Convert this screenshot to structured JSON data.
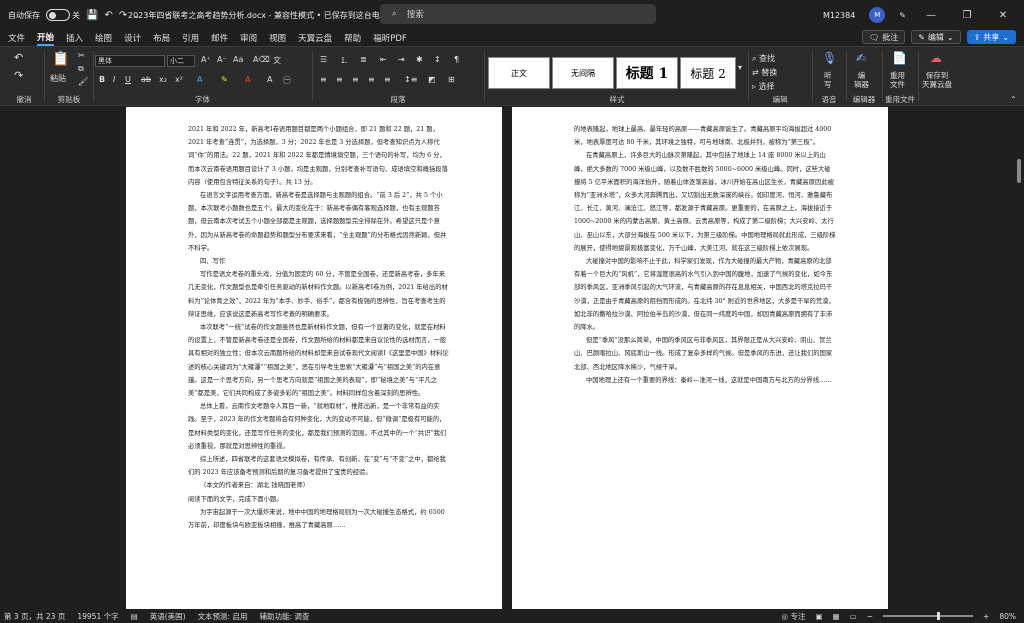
{
  "titlebar": {
    "autosave_label": "自动保存",
    "autosave_state": "关",
    "document_title": "2023年四省联考之高考趋势分析.docx  -  兼容性模式 • 已保存到这台电脑",
    "search_placeholder": "搜索",
    "user_name": "M12384",
    "avatar_initial": "M"
  },
  "tabs": [
    "文件",
    "开始",
    "插入",
    "绘图",
    "设计",
    "布局",
    "引用",
    "邮件",
    "审阅",
    "视图",
    "天翼云盘",
    "帮助",
    "福昕PDF"
  ],
  "tabs_right": {
    "comment": "批注",
    "edit": "编辑",
    "share": "共享"
  },
  "ribbon": {
    "groups": [
      "撤消",
      "剪贴板",
      "字体",
      "段落",
      "样式",
      "编辑",
      "语音",
      "编辑器",
      "重用文件"
    ],
    "paste_label": "粘贴",
    "font_name": "黑体",
    "font_size": "小二",
    "styles": [
      "正文",
      "无间隔",
      "标题 1",
      "标题 2"
    ],
    "find": "查找",
    "replace": "替换",
    "select": "选择",
    "dictate": "听\n写",
    "editor": "编\n辑器",
    "reuse": "重用\n文件",
    "save_cloud": "保存到\n天翼云盘"
  },
  "left_page": [
    {
      "t": "2021 年和 2022 年，新高考Ⅰ卷语用题目都是两个小题组合，即 21 题和 22 题，21 题，2021 年考查“连贯”，为选择题，3 分；2022 年也是 3 分选择题，但考查知识点为人称代词“你”的用法。22 题，2021 年和 2022 年都是情境填空题，三个语句的补写，均为 6 分，而本次云南卷语用题目设计了 3 小题，均是主观题，分别考查补写语句、成语填空和概括段落内容（使用包含特征关系的句子）。共 13 分。",
      "ind": false
    },
    {
      "t": "在语言文字运用考查方面，新高考卷是选择题与主观题的组合。“前 3 后 2”，共 5 个小题，本次联考小题数也是五个。最大的变化在于：新高考卷偶有客观选择题，也有主观题答题，但云南本次考试五个小题全部都是主观题，选择题题型完全排除在外。希望这只是个意外，因为从新高考卷的命题趋势和题型分布要求来看，“全主观题”的分布格式因然新颖，但并不科学。",
      "ind": true
    },
    {
      "t": "四、写作",
      "ind": true
    },
    {
      "t": "写作是语文考卷的重头戏，分值为固定的 60 分，不管是全国卷，还是新高考卷，多年来几无变化，作文题型也是牵引任务驱动的新材料作文题。以新高考Ⅰ卷为例，2021 年给出的材料为“论体育之效”，2022 年为“本手、妙手、俗手”，都含有极强的思辨性，旨在考查考生的辩证思维，应该说这是新高考写作考查的明确要求。",
      "ind": true
    },
    {
      "t": "本次联考“一统”试卷的作文题虽然也是新材料作文题，但有一个显著的变化，就是在材料的设置上，不管是新高考卷还是全国卷，作文题所给的材料都是来自议论性的选材而言，一般具有相对的独立性；但本次云南题所给的材料却是来自试卷现代文阅读Ⅰ《这里是中国》材料论述的核心关键词为“大雍瀑”“祖国之美”，恶在引导考生思索“大雍瀑”与“祖国之美”的内在意蕴。这是一个思考方向，另一个思考方向就是“祖国之美的表现”，即“秘境之美”与“平凡之美”都是美，它们共同构成了多姿多彩的“祖国之美”。材料同样包含着深刻的思辨性。",
      "ind": true
    },
    {
      "t": "总体上看，云南作文考题令人耳目一新，“就地取材”，推陈出新，是一个非常有益的实践。至于，2023 年的作文考题将会有何种变化，大的变动不可能，但“微调”是极有可能的，是材料类型的变化，还是写作任务的变化，都是我们预测的范围，不过其中的一个“共识”我们必须重视，那就是对思辨性的重视。",
      "ind": true
    },
    {
      "t": "综上所述，四省联考的这套语文模拟卷，有传承、有创新，在“变”与“不变”之中，都给我们的 2023 年应该备考预测和后期的复习备考提供了宝贵的经验。",
      "ind": true
    },
    {
      "t": "（本文的作者来自：湖北 钱晓国老师）",
      "ind": true
    },
    {
      "t": "阅读下面的文字，完成下面小题。",
      "ind": false
    },
    {
      "t": "为宇宙起源于一次大爆炸来说，地中中国的地理格局则为一次大碰撞生态格式，约 6500 万年前，印度板块与欧亚板块相撞，推高了青藏高原……",
      "ind": true
    }
  ],
  "right_page": [
    {
      "t": "的地表隆起，地球上最高、最年轻的高原——青藏高原诞生了。青藏高原平均海拔超过 4000 米，地表厚度可达 80 千米，其环境之独特，可与地球南、北极并列，被称为“第三极”。",
      "ind": false
    },
    {
      "t": "在青藏高原上，许多巨大的山脉次第隆起，其中包括了地球上 14 座 8000 米以上的山峰，绝大多数的 7000 米级山峰，以及数不胜数的 5000~6000 米级山峰。同时，这些大碰撞将 5 亿平米面积的海洋抬升，随着山体逐渐高耸，冰川开始在高山区生长，青藏高原因此被称为“亚洲水塔”，众多大河奔腾而出，又切割出无数深邃的峡谷。如印度河、恒河、雅鲁藏布江、长江、黄河、澜沧江、怒江等，都发源于青藏高原。更重要的，在高原之上，海拔接近于 1000~2000 米的内蒙古高原、黄土高原、云贵高原等，构成了第二级阶梯；大兴安岭、太行山、巫山以东，大部分海拔在 500 米以下，为第三级阶梯。中国地理格局就此形成，三级阶梯的展开，使得地貌景观极富变化，万千山峰，大美江河，就在这三级阶梯上依次展现。",
      "ind": true
    },
    {
      "t": "大碰撞对中国的影响不止于此，科学家们发现，作为大碰撞的最大产物，青藏高原的北部有着一个巨大的“风机”，它将湿度很高的水气引入到中国的腹地，加速了气候的变化，如今东部的季风区，亚洲季风引起的大气环流，与青藏高原的存在息息相关，中国西北的塔克拉玛干沙漠，正是由于青藏高原的阻挡而形成的。在北纬 30° 附近的世界地区，大多是干旱的荒漠，如北非的撒哈拉沙漠、阿拉伯半岛的沙漠，但在同一纬度的中国，却因青藏高原而拥有了丰沛的降水。",
      "ind": true
    },
    {
      "t": "但是“季风”没那么简单，中国的季风区与非季风区，其界限正是从大兴安岭、阴山、贺兰山、巴颜喀拉山、冈底斯山一线。形成了复杂多样的气候。但是季风的东进，还让我们的国家北部、西北地区降水稀少，气候干旱。",
      "ind": true
    },
    {
      "t": "中国地理上还有一个重要的界线：秦岭—淮河一线，这就是中国南方与北方的分界线……",
      "ind": true
    }
  ],
  "status": {
    "page": "第 3 页，共 23 页",
    "words": "19951 个字",
    "lang": "英语(美国)",
    "predict": "文本预测: 启用",
    "access": "辅助功能: 调查",
    "focus": "专注",
    "zoom": "80%"
  }
}
